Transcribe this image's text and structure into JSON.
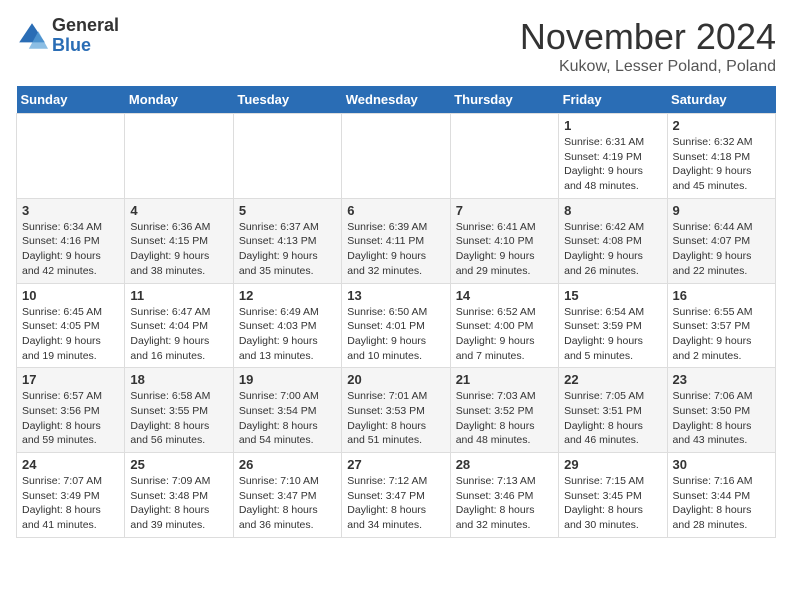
{
  "logo": {
    "general": "General",
    "blue": "Blue"
  },
  "header": {
    "month_title": "November 2024",
    "location": "Kukow, Lesser Poland, Poland"
  },
  "weekdays": [
    "Sunday",
    "Monday",
    "Tuesday",
    "Wednesday",
    "Thursday",
    "Friday",
    "Saturday"
  ],
  "weeks": [
    [
      {
        "day": "",
        "info": ""
      },
      {
        "day": "",
        "info": ""
      },
      {
        "day": "",
        "info": ""
      },
      {
        "day": "",
        "info": ""
      },
      {
        "day": "",
        "info": ""
      },
      {
        "day": "1",
        "info": "Sunrise: 6:31 AM\nSunset: 4:19 PM\nDaylight: 9 hours\nand 48 minutes."
      },
      {
        "day": "2",
        "info": "Sunrise: 6:32 AM\nSunset: 4:18 PM\nDaylight: 9 hours\nand 45 minutes."
      }
    ],
    [
      {
        "day": "3",
        "info": "Sunrise: 6:34 AM\nSunset: 4:16 PM\nDaylight: 9 hours\nand 42 minutes."
      },
      {
        "day": "4",
        "info": "Sunrise: 6:36 AM\nSunset: 4:15 PM\nDaylight: 9 hours\nand 38 minutes."
      },
      {
        "day": "5",
        "info": "Sunrise: 6:37 AM\nSunset: 4:13 PM\nDaylight: 9 hours\nand 35 minutes."
      },
      {
        "day": "6",
        "info": "Sunrise: 6:39 AM\nSunset: 4:11 PM\nDaylight: 9 hours\nand 32 minutes."
      },
      {
        "day": "7",
        "info": "Sunrise: 6:41 AM\nSunset: 4:10 PM\nDaylight: 9 hours\nand 29 minutes."
      },
      {
        "day": "8",
        "info": "Sunrise: 6:42 AM\nSunset: 4:08 PM\nDaylight: 9 hours\nand 26 minutes."
      },
      {
        "day": "9",
        "info": "Sunrise: 6:44 AM\nSunset: 4:07 PM\nDaylight: 9 hours\nand 22 minutes."
      }
    ],
    [
      {
        "day": "10",
        "info": "Sunrise: 6:45 AM\nSunset: 4:05 PM\nDaylight: 9 hours\nand 19 minutes."
      },
      {
        "day": "11",
        "info": "Sunrise: 6:47 AM\nSunset: 4:04 PM\nDaylight: 9 hours\nand 16 minutes."
      },
      {
        "day": "12",
        "info": "Sunrise: 6:49 AM\nSunset: 4:03 PM\nDaylight: 9 hours\nand 13 minutes."
      },
      {
        "day": "13",
        "info": "Sunrise: 6:50 AM\nSunset: 4:01 PM\nDaylight: 9 hours\nand 10 minutes."
      },
      {
        "day": "14",
        "info": "Sunrise: 6:52 AM\nSunset: 4:00 PM\nDaylight: 9 hours\nand 7 minutes."
      },
      {
        "day": "15",
        "info": "Sunrise: 6:54 AM\nSunset: 3:59 PM\nDaylight: 9 hours\nand 5 minutes."
      },
      {
        "day": "16",
        "info": "Sunrise: 6:55 AM\nSunset: 3:57 PM\nDaylight: 9 hours\nand 2 minutes."
      }
    ],
    [
      {
        "day": "17",
        "info": "Sunrise: 6:57 AM\nSunset: 3:56 PM\nDaylight: 8 hours\nand 59 minutes."
      },
      {
        "day": "18",
        "info": "Sunrise: 6:58 AM\nSunset: 3:55 PM\nDaylight: 8 hours\nand 56 minutes."
      },
      {
        "day": "19",
        "info": "Sunrise: 7:00 AM\nSunset: 3:54 PM\nDaylight: 8 hours\nand 54 minutes."
      },
      {
        "day": "20",
        "info": "Sunrise: 7:01 AM\nSunset: 3:53 PM\nDaylight: 8 hours\nand 51 minutes."
      },
      {
        "day": "21",
        "info": "Sunrise: 7:03 AM\nSunset: 3:52 PM\nDaylight: 8 hours\nand 48 minutes."
      },
      {
        "day": "22",
        "info": "Sunrise: 7:05 AM\nSunset: 3:51 PM\nDaylight: 8 hours\nand 46 minutes."
      },
      {
        "day": "23",
        "info": "Sunrise: 7:06 AM\nSunset: 3:50 PM\nDaylight: 8 hours\nand 43 minutes."
      }
    ],
    [
      {
        "day": "24",
        "info": "Sunrise: 7:07 AM\nSunset: 3:49 PM\nDaylight: 8 hours\nand 41 minutes."
      },
      {
        "day": "25",
        "info": "Sunrise: 7:09 AM\nSunset: 3:48 PM\nDaylight: 8 hours\nand 39 minutes."
      },
      {
        "day": "26",
        "info": "Sunrise: 7:10 AM\nSunset: 3:47 PM\nDaylight: 8 hours\nand 36 minutes."
      },
      {
        "day": "27",
        "info": "Sunrise: 7:12 AM\nSunset: 3:47 PM\nDaylight: 8 hours\nand 34 minutes."
      },
      {
        "day": "28",
        "info": "Sunrise: 7:13 AM\nSunset: 3:46 PM\nDaylight: 8 hours\nand 32 minutes."
      },
      {
        "day": "29",
        "info": "Sunrise: 7:15 AM\nSunset: 3:45 PM\nDaylight: 8 hours\nand 30 minutes."
      },
      {
        "day": "30",
        "info": "Sunrise: 7:16 AM\nSunset: 3:44 PM\nDaylight: 8 hours\nand 28 minutes."
      }
    ]
  ]
}
